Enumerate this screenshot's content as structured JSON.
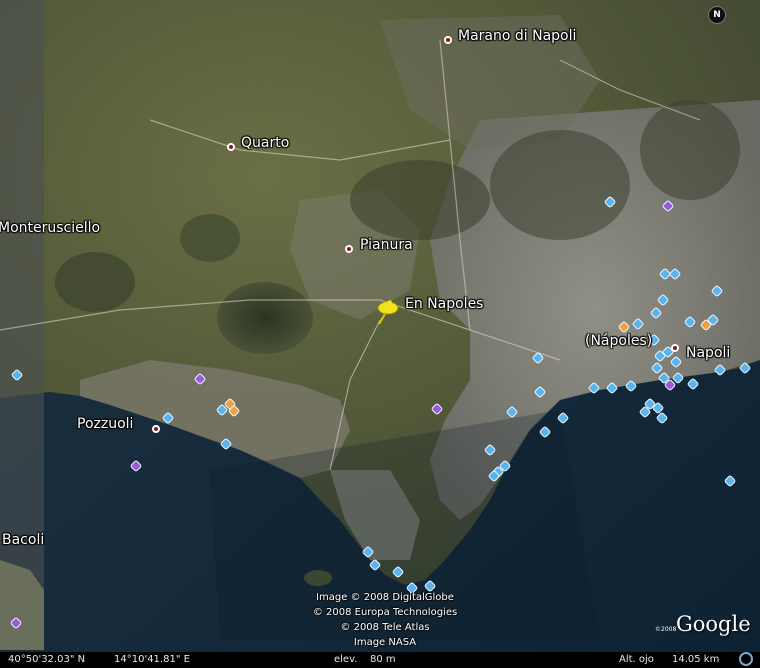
{
  "map": {
    "places": [
      {
        "name": "Marano di Napoli"
      },
      {
        "name": "Quarto"
      },
      {
        "name": "Monterusciello"
      },
      {
        "name": "Pianura"
      },
      {
        "name": "Pozzuoli"
      },
      {
        "name": "Bacoli"
      },
      {
        "name": "Napoli"
      },
      {
        "name": "(Nápoles)"
      }
    ],
    "placemark": {
      "label": "En Napoles",
      "icon": "yellow-pushpin-icon"
    },
    "compass_letter": "N",
    "colors": {
      "city_dot": "#8b1a1a",
      "photo_marker": "#5ab4ef",
      "purple_marker": "#9b59e0",
      "orange_marker": "#f0a040",
      "pin": "#f2e21b"
    }
  },
  "credits": {
    "line1": "Image © 2008 DigitalGlobe",
    "line2": "© 2008 Europa Technologies",
    "line3": "© 2008 Tele Atlas",
    "line4": "Image NASA"
  },
  "logo": {
    "text": "Google",
    "copyright": "©2008"
  },
  "status_bar": {
    "latitude": "40°50'32.03\" N",
    "longitude": "14°10'41.81\" E",
    "elevation_label": "elev.",
    "elevation_value": "80 m",
    "eye_alt_label": "Alt. ojo",
    "eye_alt_value": "14.05 km"
  }
}
